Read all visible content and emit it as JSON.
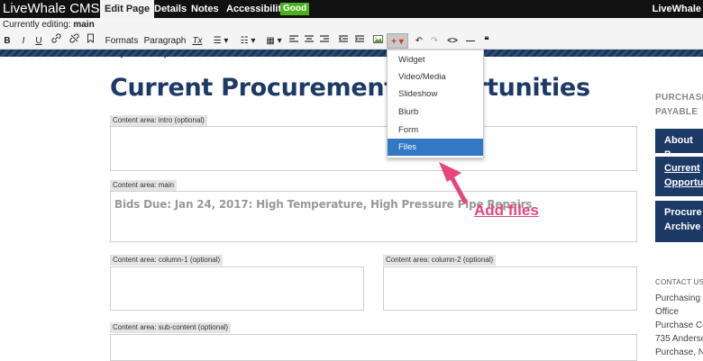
{
  "topbar": {
    "brand": "LiveWhale CMS",
    "tabs": [
      "Edit Page",
      "Details",
      "Notes",
      "Accessibility"
    ],
    "accessibility_status": "Good",
    "right_brand": "LiveWhale"
  },
  "editing": {
    "prefix": "Currently editing:",
    "page": "main"
  },
  "toolbar": {
    "bold": "B",
    "italic": "I",
    "underline": "U",
    "formats": "Formats ▾",
    "paragraph": "Paragraph ▾",
    "clear_format": "Tx",
    "bullet_list": "☰ ▾",
    "number_list": "☷ ▾",
    "table": "▦ ▾",
    "insert": "+ ▾",
    "undo": "↶",
    "redo": "↷",
    "code": "<>",
    "hr": "—",
    "quote": "❝"
  },
  "page": {
    "title": "Current Procurement Opportunities",
    "areas": {
      "intro": "Content area: intro (optional)",
      "main": "Content area: main",
      "col1": "Content area: column-1 (optional)",
      "col2": "Content area: column-2 (optional)",
      "sub": "Content area: sub-content (optional)"
    },
    "main_text": "Bids Due: Jan 24, 2017: High Temperature, High Pressure Pipe Repairs"
  },
  "sidebar": {
    "heading_line1": "PURCHASI",
    "heading_line2": "PAYABLE",
    "buttons": [
      {
        "line1": "About P",
        "line2": ""
      },
      {
        "line1": "Current",
        "line2": "Opportu"
      },
      {
        "line1": "Procure",
        "line2": "Archive"
      }
    ],
    "contact_heading": "CONTACT US",
    "contact_lines": [
      "Purchasing &",
      "Office",
      "Purchase Co",
      "735 Anderso",
      "Purchase, N"
    ]
  },
  "dropdown": {
    "items": [
      "Widget",
      "Video/Media",
      "Slideshow",
      "Blurb",
      "Form",
      "Files"
    ],
    "active_index": 5
  },
  "annotation": {
    "text": "Add files",
    "color": "#e8447e"
  },
  "colors": {
    "accent": "#1d3a66",
    "menu_active": "#3179c4",
    "good": "#4caf1f"
  }
}
